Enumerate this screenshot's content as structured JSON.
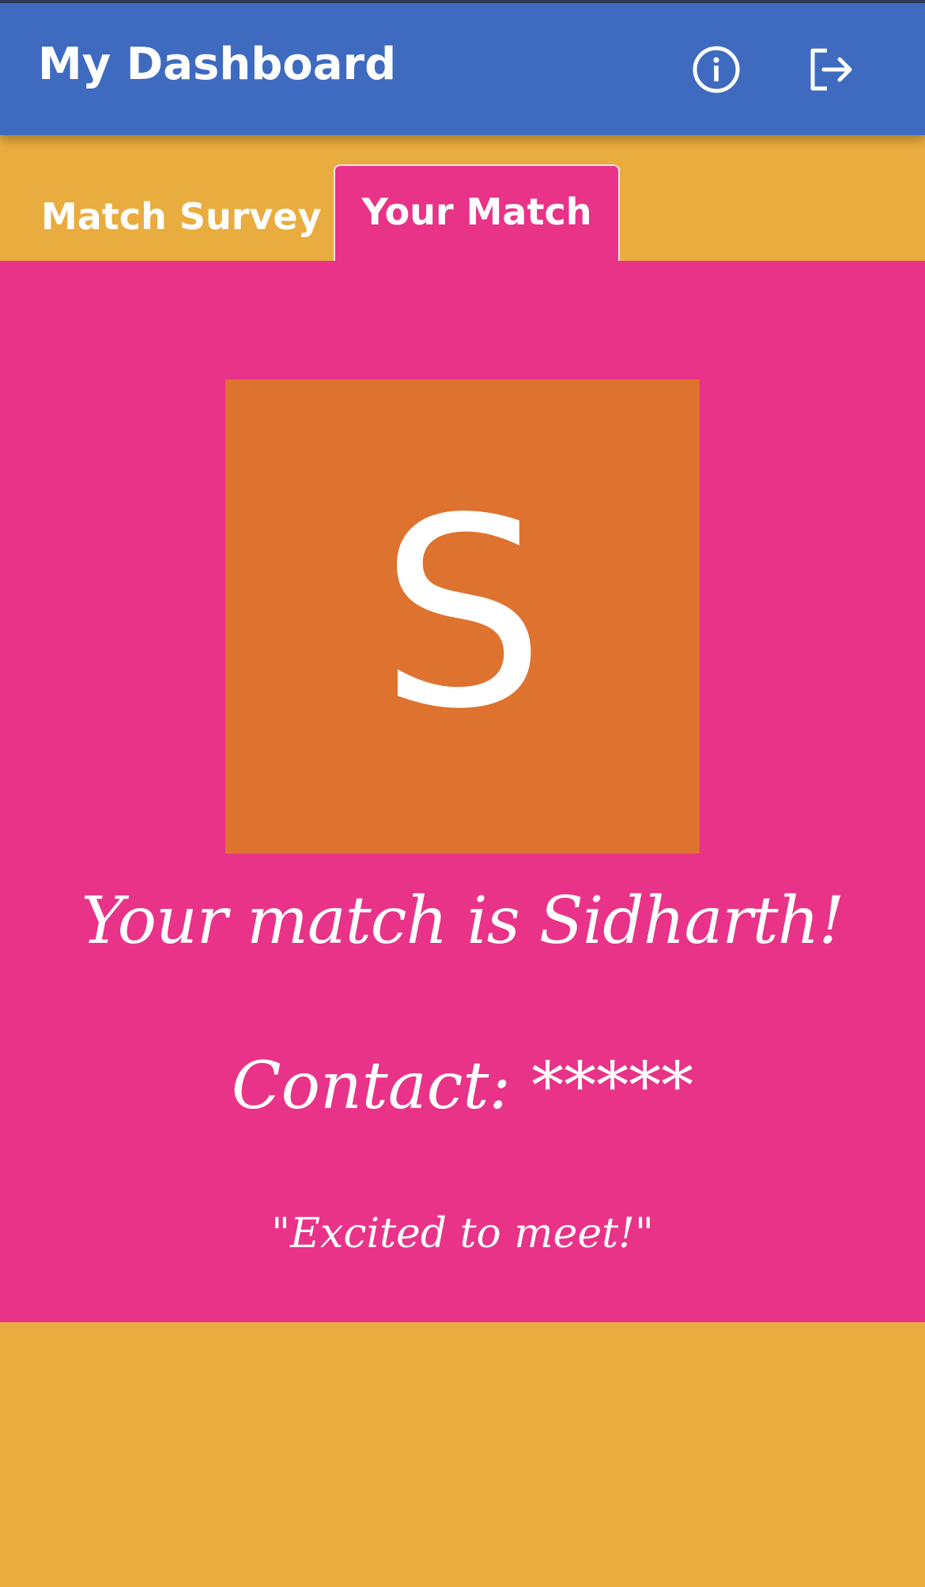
{
  "app_bar": {
    "title": "My Dashboard",
    "color": "#3e6bbf",
    "icons": [
      "info-icon",
      "logout-icon"
    ]
  },
  "tabs": [
    {
      "label": "Match Survey",
      "selected": false
    },
    {
      "label": "Your Match",
      "selected": true
    }
  ],
  "match": {
    "avatar_letter": "S",
    "headline": "Your match is Sidharth!",
    "contact": "Contact: *****",
    "quote": "\"Excited to meet!\""
  },
  "colors": {
    "background": "#e9ac3e",
    "panel": "#e83388",
    "avatar": "#de722f",
    "text": "#ffffff"
  }
}
